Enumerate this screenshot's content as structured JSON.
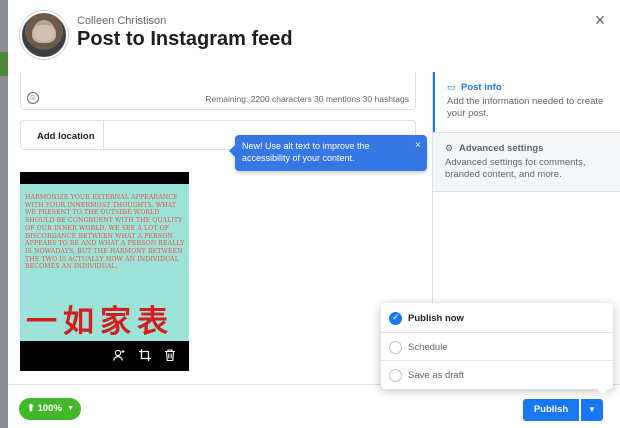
{
  "header": {
    "account_name": "Colleen Christison",
    "title": "Post to Instagram feed",
    "close_icon": "close-icon"
  },
  "composer": {
    "remaining": "Remaining: 2200 characters 30 mentions 30 hashtags",
    "emoji_icon": "emoji-icon"
  },
  "location": {
    "label": "Add location"
  },
  "tooltip": {
    "text": "New! Use alt text to improve the accessibility of your content.",
    "close": "×"
  },
  "media": {
    "quote": "Harmonize your external appearance with your innermost thoughts. What we present to the outside world should be congruent with the quality of our inner world. We see a lot of discordance between what a person appears to be and what a person really is nowadays, but the harmony between the two is actually how an individual becomes an individual.",
    "calligraphy": "一如家表",
    "colors": {
      "background": "#9ee3d9",
      "text": "#e2584e",
      "calligraphy": "#d21f1f"
    },
    "tools": [
      "tag-person-icon",
      "crop-icon",
      "trash-icon"
    ]
  },
  "sidebar": {
    "items": [
      {
        "title": "Post info",
        "description": "Add the information needed to create your post.",
        "icon": "post-info-icon",
        "active": true
      },
      {
        "title": "Advanced settings",
        "description": "Advanced settings for comments, branded content, and more.",
        "icon": "gear-icon",
        "active": false
      }
    ]
  },
  "footer": {
    "zoom_label": "100%",
    "publish_label": "Publish"
  },
  "publish_menu": {
    "options": [
      {
        "label": "Publish now",
        "selected": true
      },
      {
        "label": "Schedule",
        "selected": false
      },
      {
        "label": "Save as draft",
        "selected": false
      }
    ]
  },
  "colors": {
    "accent": "#1877f2",
    "tooltip": "#3578e5",
    "zoom": "#42b72a"
  }
}
